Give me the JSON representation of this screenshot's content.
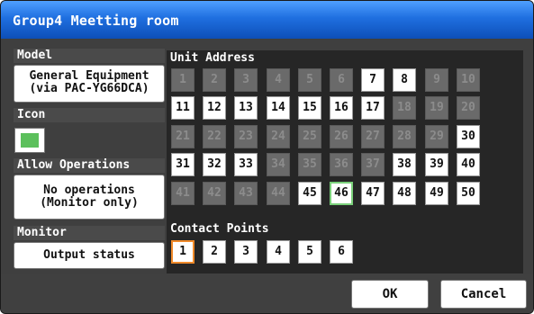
{
  "title": "Group4 Meetting room",
  "model": {
    "label": "Model",
    "button": [
      "General Equipment",
      "(via PAC-YG66DCA)"
    ]
  },
  "icon": {
    "label": "Icon",
    "color": "#5cc05c"
  },
  "allow_operations": {
    "label": "Allow Operations",
    "button": [
      "No operations",
      "(Monitor only)"
    ]
  },
  "monitor": {
    "label": "Monitor",
    "button": "Output status"
  },
  "unit_address": {
    "label": "Unit Address",
    "cells": [
      {
        "n": "1",
        "on": false
      },
      {
        "n": "2",
        "on": false
      },
      {
        "n": "3",
        "on": false
      },
      {
        "n": "4",
        "on": false
      },
      {
        "n": "5",
        "on": false
      },
      {
        "n": "6",
        "on": false
      },
      {
        "n": "7",
        "on": true
      },
      {
        "n": "8",
        "on": true
      },
      {
        "n": "9",
        "on": false
      },
      {
        "n": "10",
        "on": false
      },
      {
        "n": "11",
        "on": true
      },
      {
        "n": "12",
        "on": true
      },
      {
        "n": "13",
        "on": true
      },
      {
        "n": "14",
        "on": true
      },
      {
        "n": "15",
        "on": true
      },
      {
        "n": "16",
        "on": true
      },
      {
        "n": "17",
        "on": true
      },
      {
        "n": "18",
        "on": false
      },
      {
        "n": "19",
        "on": false
      },
      {
        "n": "20",
        "on": false
      },
      {
        "n": "21",
        "on": false
      },
      {
        "n": "22",
        "on": false
      },
      {
        "n": "23",
        "on": false
      },
      {
        "n": "24",
        "on": false
      },
      {
        "n": "25",
        "on": false
      },
      {
        "n": "26",
        "on": false
      },
      {
        "n": "27",
        "on": false
      },
      {
        "n": "28",
        "on": false
      },
      {
        "n": "29",
        "on": false
      },
      {
        "n": "30",
        "on": true
      },
      {
        "n": "31",
        "on": true
      },
      {
        "n": "32",
        "on": true
      },
      {
        "n": "33",
        "on": true
      },
      {
        "n": "34",
        "on": false
      },
      {
        "n": "35",
        "on": false
      },
      {
        "n": "36",
        "on": false
      },
      {
        "n": "37",
        "on": false
      },
      {
        "n": "38",
        "on": true
      },
      {
        "n": "39",
        "on": true
      },
      {
        "n": "40",
        "on": true
      },
      {
        "n": "41",
        "on": false
      },
      {
        "n": "42",
        "on": false
      },
      {
        "n": "43",
        "on": false
      },
      {
        "n": "44",
        "on": false
      },
      {
        "n": "45",
        "on": true
      },
      {
        "n": "46",
        "on": true,
        "selected": true
      },
      {
        "n": "47",
        "on": true
      },
      {
        "n": "48",
        "on": true
      },
      {
        "n": "49",
        "on": true
      },
      {
        "n": "50",
        "on": true
      }
    ]
  },
  "contact_points": {
    "label": "Contact Points",
    "cells": [
      {
        "n": "1",
        "selected": true
      },
      {
        "n": "2"
      },
      {
        "n": "3"
      },
      {
        "n": "4"
      },
      {
        "n": "5"
      },
      {
        "n": "6"
      }
    ]
  },
  "buttons": {
    "ok": "OK",
    "cancel": "Cancel"
  }
}
